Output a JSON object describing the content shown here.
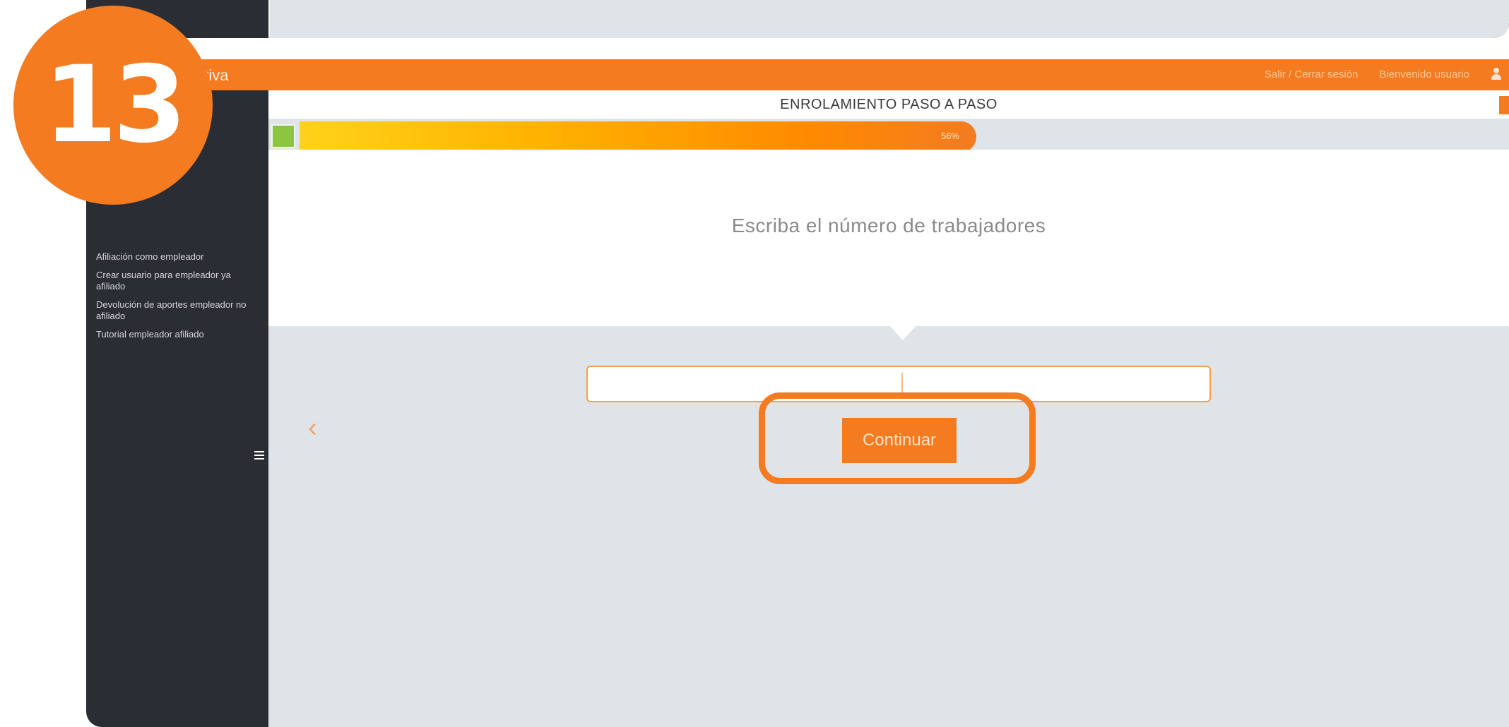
{
  "step_badge": "13",
  "app": {
    "brand_fragment": "ativa",
    "topbar_links": [
      "Salir / Cerrar sesión",
      "Bienvenido usuario"
    ]
  },
  "page": {
    "title": "ENROLAMIENTO PASO A PASO",
    "progress_label": "56%",
    "progress_fraction": 0.56,
    "question": "Escriba el número de trabajadores",
    "input_value": "",
    "continue_label": "Continuar"
  },
  "sidebar": {
    "items": [
      "Afiliación como empleador",
      "Crear usuario para empleador ya afiliado",
      "Devolución de aportes empleador no afiliado",
      "Tutorial empleador afiliado"
    ]
  },
  "icons": {
    "user": "user-icon",
    "menu": "hamburger-icon",
    "back": "chevron-left-icon"
  },
  "colors": {
    "accent": "#f47b20",
    "sidebar": "#2a2d33",
    "background": "#dfe4e8",
    "progress_start": "#8cc63f"
  }
}
